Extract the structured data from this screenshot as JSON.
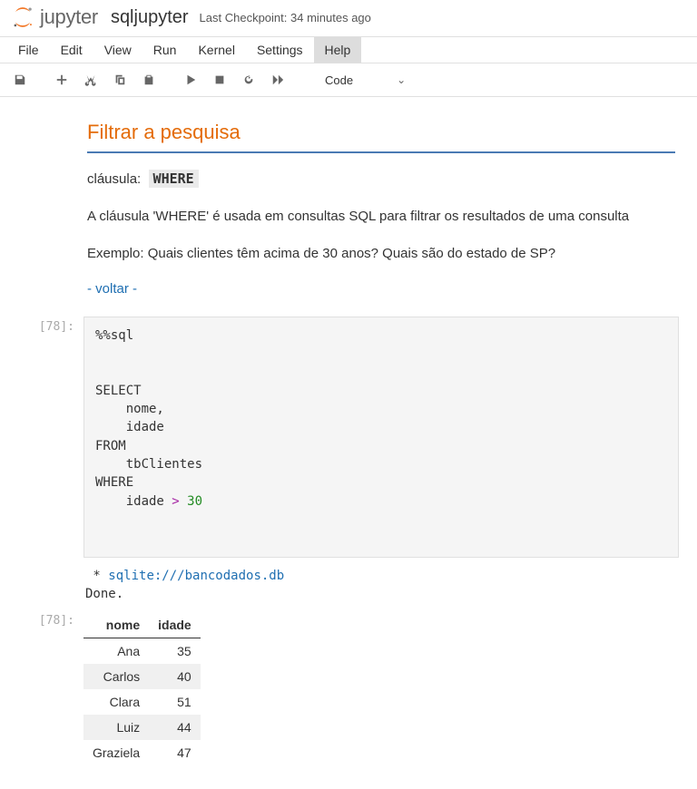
{
  "header": {
    "logo_text": "jupyter",
    "notebook_name": "sqljupyter",
    "checkpoint": "Last Checkpoint: 34 minutes ago"
  },
  "menu": {
    "items": [
      "File",
      "Edit",
      "View",
      "Run",
      "Kernel",
      "Settings",
      "Help"
    ],
    "hovered_index": 6
  },
  "toolbar": {
    "cell_type": "Code"
  },
  "markdown": {
    "heading": "Filtrar a pesquisa",
    "label_clause": "cláusula:",
    "clause_code": "WHERE",
    "desc": "A cláusula 'WHERE' é usada em consultas SQL para filtrar os resultados de uma consulta",
    "example": "Exemplo: Quais clientes têm acima de 30 anos? Quais são do estado de SP?",
    "back_link": "- voltar -"
  },
  "cells": {
    "input_prompt": "[78]:",
    "output_prompt": "[78]:",
    "code": {
      "magic": "%%sql",
      "lines": [
        "",
        "",
        "SELECT",
        "    nome,",
        "    idade",
        "FROM",
        "    tbClientes",
        "WHERE",
        "    idade > 30"
      ]
    },
    "output": {
      "star": " * ",
      "db_link": "sqlite:///bancodados.db",
      "done": "Done."
    },
    "table": {
      "headers": [
        "nome",
        "idade"
      ],
      "rows": [
        [
          "Ana",
          "35"
        ],
        [
          "Carlos",
          "40"
        ],
        [
          "Clara",
          "51"
        ],
        [
          "Luiz",
          "44"
        ],
        [
          "Graziela",
          "47"
        ]
      ]
    }
  }
}
